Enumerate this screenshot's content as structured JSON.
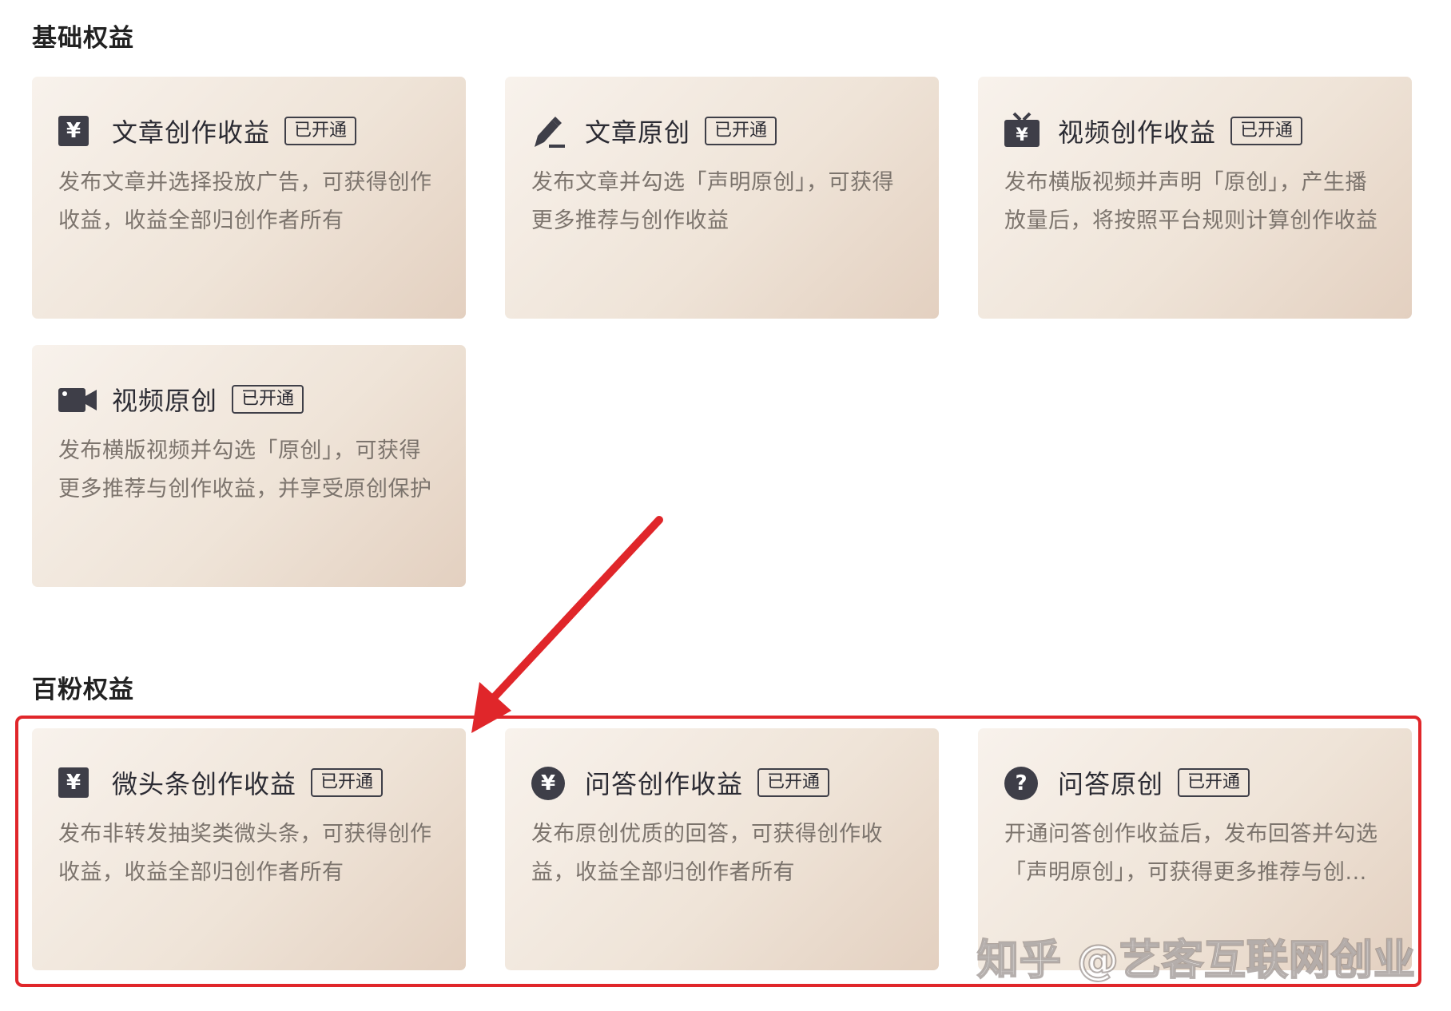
{
  "sections": [
    {
      "title": "基础权益",
      "cards": [
        {
          "title": "文章创作收益",
          "badge": "已开通",
          "desc": "发布文章并选择投放广告，可获得创作收益，收益全部归创作者所有",
          "icon": "yen-square-icon"
        },
        {
          "title": "文章原创",
          "badge": "已开通",
          "desc": "发布文章并勾选「声明原创」，可获得更多推荐与创作收益",
          "icon": "pen-icon"
        },
        {
          "title": "视频创作收益",
          "badge": "已开通",
          "desc": "发布横版视频并声明「原创」，产生播放量后，将按照平台规则计算创作收益",
          "icon": "tv-yen-icon"
        },
        {
          "title": "视频原创",
          "badge": "已开通",
          "desc": "发布横版视频并勾选「原创」，可获得更多推荐与创作收益，并享受原创保护",
          "icon": "video-camera-icon"
        }
      ]
    },
    {
      "title": "百粉权益",
      "cards": [
        {
          "title": "微头条创作收益",
          "badge": "已开通",
          "desc": "发布非转发抽奖类微头条，可获得创作收益，收益全部归创作者所有",
          "icon": "yen-square-icon"
        },
        {
          "title": "问答创作收益",
          "badge": "已开通",
          "desc": "发布原创优质的回答，可获得创作收益，收益全部归创作者所有",
          "icon": "yen-circle-icon"
        },
        {
          "title": "问答原创",
          "badge": "已开通",
          "desc": "开通问答创作收益后，发布回答并勾选「声明原创」，可获得更多推荐与创...",
          "icon": "question-circle-icon"
        }
      ]
    }
  ],
  "icons": {
    "yen": "¥",
    "question": "?"
  },
  "watermark": "知乎 @艺客互联网创业",
  "colors": {
    "highlight": "#e0262a",
    "arrow": "#e0262a",
    "icon": "#3e3e48"
  }
}
